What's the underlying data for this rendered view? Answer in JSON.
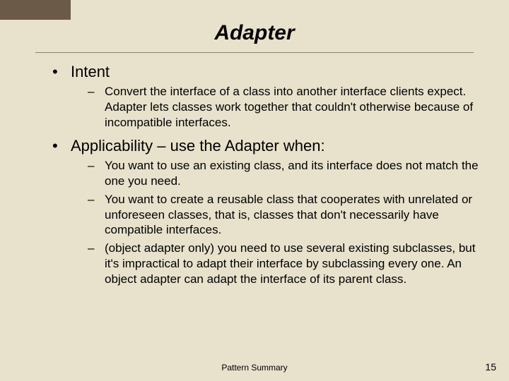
{
  "title": "Adapter",
  "bullets": [
    {
      "label": "Intent",
      "subs": [
        "Convert the interface of a class into another interface clients expect.  Adapter lets classes work together that couldn't otherwise because of incompatible interfaces."
      ]
    },
    {
      "label": "Applicability – use the Adapter when:",
      "subs": [
        "You want to use an existing class, and its interface does not match the one you need.",
        "You want to create a reusable class that cooperates with unrelated or unforeseen classes, that is, classes that don't necessarily have compatible interfaces.",
        "(object adapter only) you need to use several existing subclasses, but it's impractical to adapt their interface by subclassing every one.  An object adapter can adapt the interface of its parent class."
      ]
    }
  ],
  "footer_center": "Pattern Summary",
  "slide_number": "15"
}
